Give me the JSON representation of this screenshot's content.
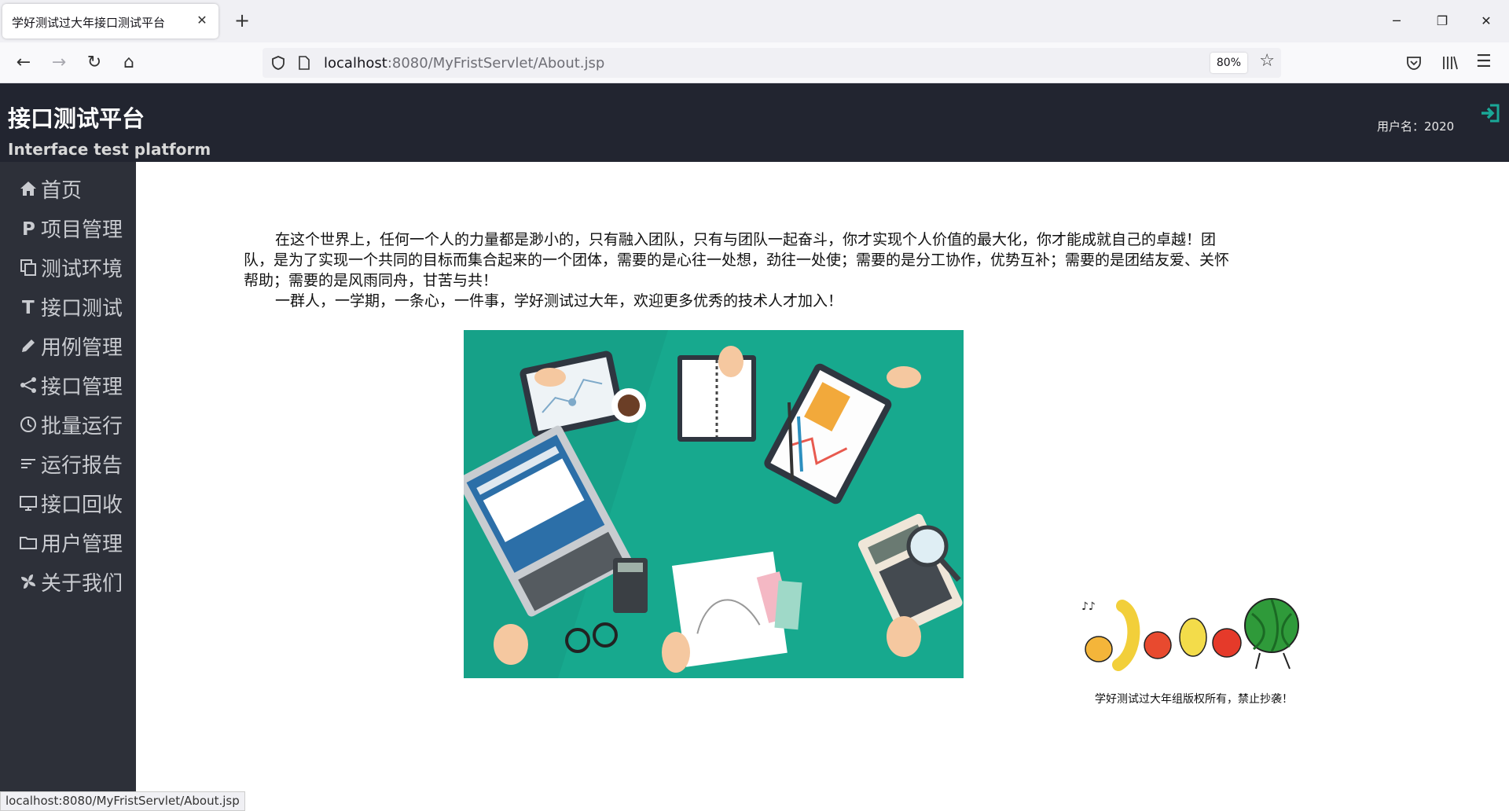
{
  "browser": {
    "tab_title": "学好测试过大年接口测试平台",
    "url_host": "localhost",
    "url_rest": ":8080/MyFristServlet/About.jsp",
    "zoom": "80%",
    "status_url": "localhost:8080/MyFristServlet/About.jsp"
  },
  "header": {
    "title_cn": "接口测试平台",
    "title_en": "Interface test platform",
    "username": "用户名：2020"
  },
  "sidebar": {
    "items": [
      {
        "label": "首页",
        "icon": "home-icon"
      },
      {
        "label": "项目管理",
        "icon": "p-letter-icon"
      },
      {
        "label": "测试环境",
        "icon": "copy-icon"
      },
      {
        "label": "接口测试",
        "icon": "t-letter-icon"
      },
      {
        "label": "用例管理",
        "icon": "pencil-icon"
      },
      {
        "label": "接口管理",
        "icon": "share-icon"
      },
      {
        "label": "批量运行",
        "icon": "clock-icon"
      },
      {
        "label": "运行报告",
        "icon": "lines-icon"
      },
      {
        "label": "接口回收",
        "icon": "monitor-icon"
      },
      {
        "label": "用户管理",
        "icon": "folder-icon"
      },
      {
        "label": "关于我们",
        "icon": "pinwheel-icon"
      }
    ]
  },
  "content": {
    "paragraph1": "在这个世界上，任何一个人的力量都是渺小的，只有融入团队，只有与团队一起奋斗，你才实现个人价值的最大化，你才能成就自己的卓越！团队，是为了实现一个共同的目标而集合起来的一个团体，需要的是心往一处想，劲往一处使；需要的是分工协作，优势互补；需要的是团结友爱、关怀帮助；需要的是风雨同舟，甘苦与共！",
    "paragraph2": "一群人，一学期，一条心，一件事，学好测试过大年，欢迎更多优秀的技术人才加入！",
    "copyright": "学好测试过大年组版权所有，禁止抄袭！"
  },
  "colors": {
    "header_bg": "#222530",
    "sidebar_bg": "#2d3039",
    "accent": "#1aa897",
    "picture_bg": "#17a98e"
  }
}
